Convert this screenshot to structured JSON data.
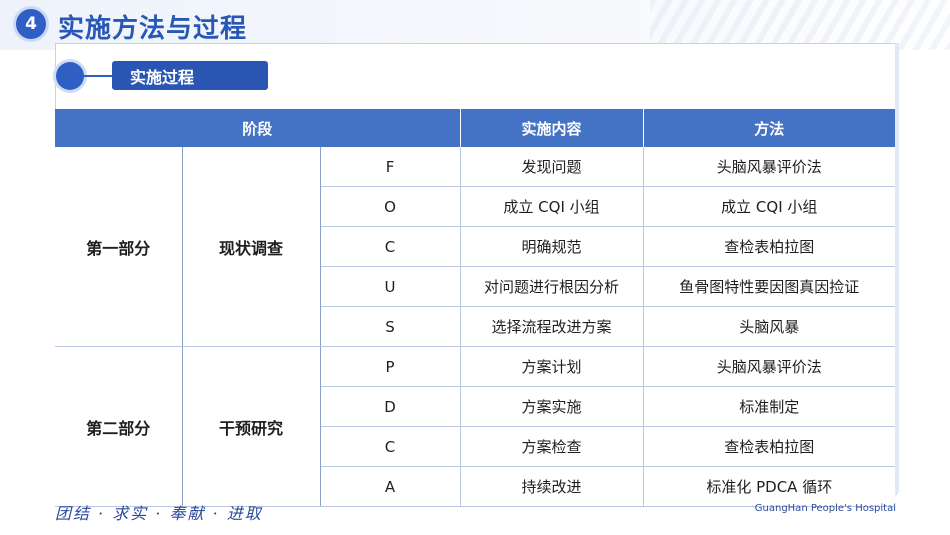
{
  "header": {
    "number": "4",
    "title": "实施方法与过程"
  },
  "section": {
    "label": "实施过程"
  },
  "table": {
    "columns": [
      "阶段",
      "实施内容",
      "方法"
    ],
    "groups": [
      {
        "part": "第一部分",
        "stage": "现状调查",
        "rows": [
          {
            "letter": "F",
            "content": "发现问题",
            "method": "头脑风暴评价法"
          },
          {
            "letter": "O",
            "content": "成立 CQI 小组",
            "method": "成立 CQI 小组"
          },
          {
            "letter": "C",
            "content": "明确规范",
            "method": "查检表柏拉图"
          },
          {
            "letter": "U",
            "content": "对问题进行根因分析",
            "method": "鱼骨图特性要因图真因捡证"
          },
          {
            "letter": "S",
            "content": "选择流程改进方案",
            "method": "头脑风暴"
          }
        ]
      },
      {
        "part": "第二部分",
        "stage": "干预研究",
        "rows": [
          {
            "letter": "P",
            "content": "方案计划",
            "method": "头脑风暴评价法"
          },
          {
            "letter": "D",
            "content": "方案实施",
            "method": "标准制定"
          },
          {
            "letter": "C",
            "content": "方案检查",
            "method": "查检表柏拉图"
          },
          {
            "letter": "A",
            "content": "持续改进",
            "method": "标准化 PDCA 循环"
          }
        ]
      }
    ]
  },
  "footer": {
    "motto": "团结 · 求实 · 奉献 · 进取",
    "hospital": "GuangHan People's Hospital"
  },
  "colors": {
    "primary": "#2f5fc4",
    "header_fill": "#4472c4",
    "title": "#2857b8"
  }
}
